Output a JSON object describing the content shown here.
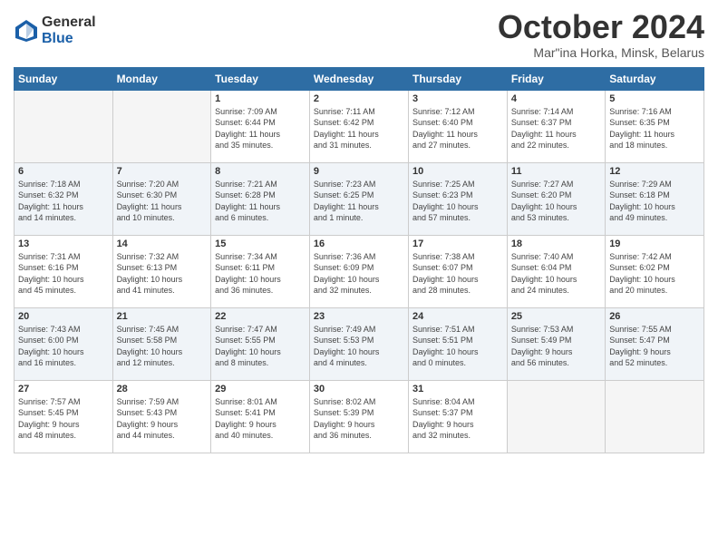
{
  "logo": {
    "general": "General",
    "blue": "Blue"
  },
  "title": "October 2024",
  "subtitle": "Mar\"ina Horka, Minsk, Belarus",
  "headers": [
    "Sunday",
    "Monday",
    "Tuesday",
    "Wednesday",
    "Thursday",
    "Friday",
    "Saturday"
  ],
  "weeks": [
    [
      {
        "num": "",
        "detail": ""
      },
      {
        "num": "",
        "detail": ""
      },
      {
        "num": "1",
        "detail": "Sunrise: 7:09 AM\nSunset: 6:44 PM\nDaylight: 11 hours\nand 35 minutes."
      },
      {
        "num": "2",
        "detail": "Sunrise: 7:11 AM\nSunset: 6:42 PM\nDaylight: 11 hours\nand 31 minutes."
      },
      {
        "num": "3",
        "detail": "Sunrise: 7:12 AM\nSunset: 6:40 PM\nDaylight: 11 hours\nand 27 minutes."
      },
      {
        "num": "4",
        "detail": "Sunrise: 7:14 AM\nSunset: 6:37 PM\nDaylight: 11 hours\nand 22 minutes."
      },
      {
        "num": "5",
        "detail": "Sunrise: 7:16 AM\nSunset: 6:35 PM\nDaylight: 11 hours\nand 18 minutes."
      }
    ],
    [
      {
        "num": "6",
        "detail": "Sunrise: 7:18 AM\nSunset: 6:32 PM\nDaylight: 11 hours\nand 14 minutes."
      },
      {
        "num": "7",
        "detail": "Sunrise: 7:20 AM\nSunset: 6:30 PM\nDaylight: 11 hours\nand 10 minutes."
      },
      {
        "num": "8",
        "detail": "Sunrise: 7:21 AM\nSunset: 6:28 PM\nDaylight: 11 hours\nand 6 minutes."
      },
      {
        "num": "9",
        "detail": "Sunrise: 7:23 AM\nSunset: 6:25 PM\nDaylight: 11 hours\nand 1 minute."
      },
      {
        "num": "10",
        "detail": "Sunrise: 7:25 AM\nSunset: 6:23 PM\nDaylight: 10 hours\nand 57 minutes."
      },
      {
        "num": "11",
        "detail": "Sunrise: 7:27 AM\nSunset: 6:20 PM\nDaylight: 10 hours\nand 53 minutes."
      },
      {
        "num": "12",
        "detail": "Sunrise: 7:29 AM\nSunset: 6:18 PM\nDaylight: 10 hours\nand 49 minutes."
      }
    ],
    [
      {
        "num": "13",
        "detail": "Sunrise: 7:31 AM\nSunset: 6:16 PM\nDaylight: 10 hours\nand 45 minutes."
      },
      {
        "num": "14",
        "detail": "Sunrise: 7:32 AM\nSunset: 6:13 PM\nDaylight: 10 hours\nand 41 minutes."
      },
      {
        "num": "15",
        "detail": "Sunrise: 7:34 AM\nSunset: 6:11 PM\nDaylight: 10 hours\nand 36 minutes."
      },
      {
        "num": "16",
        "detail": "Sunrise: 7:36 AM\nSunset: 6:09 PM\nDaylight: 10 hours\nand 32 minutes."
      },
      {
        "num": "17",
        "detail": "Sunrise: 7:38 AM\nSunset: 6:07 PM\nDaylight: 10 hours\nand 28 minutes."
      },
      {
        "num": "18",
        "detail": "Sunrise: 7:40 AM\nSunset: 6:04 PM\nDaylight: 10 hours\nand 24 minutes."
      },
      {
        "num": "19",
        "detail": "Sunrise: 7:42 AM\nSunset: 6:02 PM\nDaylight: 10 hours\nand 20 minutes."
      }
    ],
    [
      {
        "num": "20",
        "detail": "Sunrise: 7:43 AM\nSunset: 6:00 PM\nDaylight: 10 hours\nand 16 minutes."
      },
      {
        "num": "21",
        "detail": "Sunrise: 7:45 AM\nSunset: 5:58 PM\nDaylight: 10 hours\nand 12 minutes."
      },
      {
        "num": "22",
        "detail": "Sunrise: 7:47 AM\nSunset: 5:55 PM\nDaylight: 10 hours\nand 8 minutes."
      },
      {
        "num": "23",
        "detail": "Sunrise: 7:49 AM\nSunset: 5:53 PM\nDaylight: 10 hours\nand 4 minutes."
      },
      {
        "num": "24",
        "detail": "Sunrise: 7:51 AM\nSunset: 5:51 PM\nDaylight: 10 hours\nand 0 minutes."
      },
      {
        "num": "25",
        "detail": "Sunrise: 7:53 AM\nSunset: 5:49 PM\nDaylight: 9 hours\nand 56 minutes."
      },
      {
        "num": "26",
        "detail": "Sunrise: 7:55 AM\nSunset: 5:47 PM\nDaylight: 9 hours\nand 52 minutes."
      }
    ],
    [
      {
        "num": "27",
        "detail": "Sunrise: 7:57 AM\nSunset: 5:45 PM\nDaylight: 9 hours\nand 48 minutes."
      },
      {
        "num": "28",
        "detail": "Sunrise: 7:59 AM\nSunset: 5:43 PM\nDaylight: 9 hours\nand 44 minutes."
      },
      {
        "num": "29",
        "detail": "Sunrise: 8:01 AM\nSunset: 5:41 PM\nDaylight: 9 hours\nand 40 minutes."
      },
      {
        "num": "30",
        "detail": "Sunrise: 8:02 AM\nSunset: 5:39 PM\nDaylight: 9 hours\nand 36 minutes."
      },
      {
        "num": "31",
        "detail": "Sunrise: 8:04 AM\nSunset: 5:37 PM\nDaylight: 9 hours\nand 32 minutes."
      },
      {
        "num": "",
        "detail": ""
      },
      {
        "num": "",
        "detail": ""
      }
    ]
  ]
}
